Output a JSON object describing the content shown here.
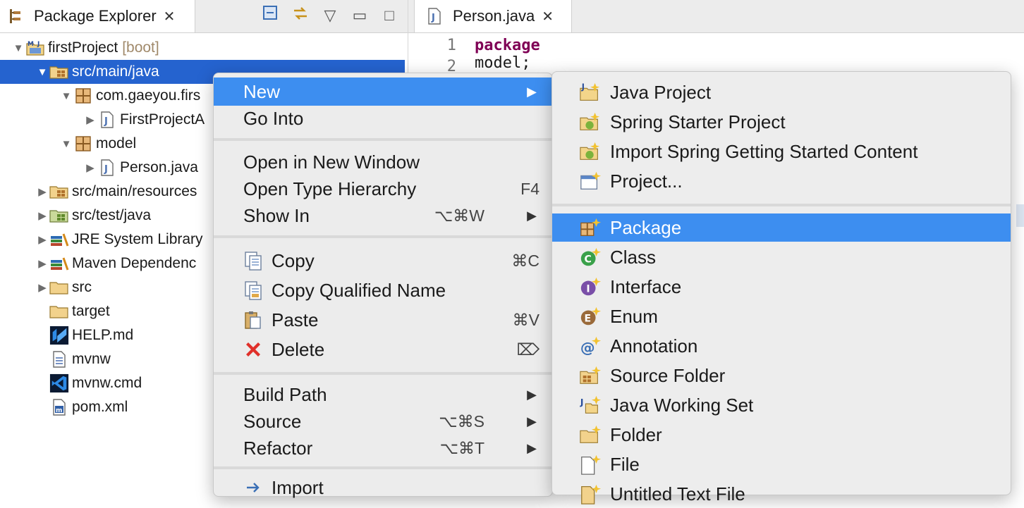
{
  "explorer": {
    "tab_label": "Package Explorer",
    "tree": [
      {
        "label": "firstProject",
        "decoration": "[boot]",
        "indent": 0,
        "twisty": "expanded",
        "icon": "project-icon"
      },
      {
        "label": "src/main/java",
        "indent": 1,
        "twisty": "expanded",
        "icon": "source-folder-icon",
        "selected": true
      },
      {
        "label": "com.gaeyou.firs",
        "indent": 2,
        "twisty": "expanded",
        "icon": "package-icon"
      },
      {
        "label": "FirstProjectA",
        "indent": 3,
        "twisty": "collapsed",
        "icon": "java-file-icon"
      },
      {
        "label": "model",
        "indent": 2,
        "twisty": "expanded",
        "icon": "package-icon"
      },
      {
        "label": "Person.java",
        "indent": 3,
        "twisty": "collapsed",
        "icon": "java-file-icon"
      },
      {
        "label": "src/main/resources",
        "indent": 1,
        "twisty": "collapsed",
        "icon": "source-folder-icon"
      },
      {
        "label": "src/test/java",
        "indent": 1,
        "twisty": "collapsed",
        "icon": "test-source-folder-icon"
      },
      {
        "label": "JRE System Library",
        "indent": 1,
        "twisty": "collapsed",
        "icon": "library-icon"
      },
      {
        "label": "Maven Dependenc",
        "indent": 1,
        "twisty": "collapsed",
        "icon": "library-icon"
      },
      {
        "label": "src",
        "indent": 1,
        "twisty": "collapsed",
        "icon": "folder-icon"
      },
      {
        "label": "target",
        "indent": 1,
        "twisty": "none",
        "icon": "folder-icon"
      },
      {
        "label": "HELP.md",
        "indent": 1,
        "twisty": "none",
        "icon": "markdown-file-icon"
      },
      {
        "label": "mvnw",
        "indent": 1,
        "twisty": "none",
        "icon": "text-file-icon"
      },
      {
        "label": "mvnw.cmd",
        "indent": 1,
        "twisty": "none",
        "icon": "vscode-file-icon"
      },
      {
        "label": "pom.xml",
        "indent": 1,
        "twisty": "none",
        "icon": "maven-pom-icon"
      }
    ]
  },
  "editor": {
    "tab_label": "Person.java",
    "lines": [
      {
        "num": "1",
        "keyword": "package",
        "rest": " model;"
      },
      {
        "num": "2",
        "keyword": "",
        "rest": ""
      }
    ]
  },
  "context_menu": {
    "items": [
      {
        "label": "New",
        "submenu": true,
        "highlighted": true
      },
      {
        "label": "Go Into"
      },
      {
        "separator": true
      },
      {
        "label": "Open in New Window"
      },
      {
        "label": "Open Type Hierarchy",
        "shortcut": "F4"
      },
      {
        "label": "Show In",
        "shortcut": "⌥⌘W",
        "submenu": true
      },
      {
        "separator": true
      },
      {
        "label": "Copy",
        "shortcut": "⌘C",
        "icon": "copy-icon"
      },
      {
        "label": "Copy Qualified Name",
        "icon": "copy-qualified-name-icon"
      },
      {
        "label": "Paste",
        "shortcut": "⌘V",
        "icon": "paste-icon"
      },
      {
        "label": "Delete",
        "shortcut": "⌦",
        "icon": "delete-icon"
      },
      {
        "separator": true
      },
      {
        "label": "Build Path",
        "submenu": true
      },
      {
        "label": "Source",
        "shortcut": "⌥⌘S",
        "submenu": true
      },
      {
        "label": "Refactor",
        "shortcut": "⌥⌘T",
        "submenu": true
      },
      {
        "separator": true
      },
      {
        "label": "Import",
        "icon": "import-icon"
      }
    ]
  },
  "new_submenu": {
    "items": [
      {
        "label": "Java Project",
        "icon": "java-project-icon"
      },
      {
        "label": "Spring Starter Project",
        "icon": "spring-starter-icon"
      },
      {
        "label": "Import Spring Getting Started Content",
        "icon": "spring-import-icon"
      },
      {
        "label": "Project...",
        "icon": "new-project-icon"
      },
      {
        "separator": true
      },
      {
        "label": "Package",
        "icon": "new-package-icon",
        "highlighted": true
      },
      {
        "label": "Class",
        "icon": "new-class-icon"
      },
      {
        "label": "Interface",
        "icon": "new-interface-icon"
      },
      {
        "label": "Enum",
        "icon": "new-enum-icon"
      },
      {
        "label": "Annotation",
        "icon": "new-annotation-icon"
      },
      {
        "label": "Source Folder",
        "icon": "new-source-folder-icon"
      },
      {
        "label": "Java Working Set",
        "icon": "java-working-set-icon"
      },
      {
        "label": "Folder",
        "icon": "new-folder-icon"
      },
      {
        "label": "File",
        "icon": "new-file-icon"
      },
      {
        "label": "Untitled Text File",
        "icon": "untitled-text-file-icon"
      }
    ]
  },
  "colors": {
    "selection": "#2563cf",
    "menu_highlight": "#3d8ef0",
    "keyword": "#7f0055"
  }
}
